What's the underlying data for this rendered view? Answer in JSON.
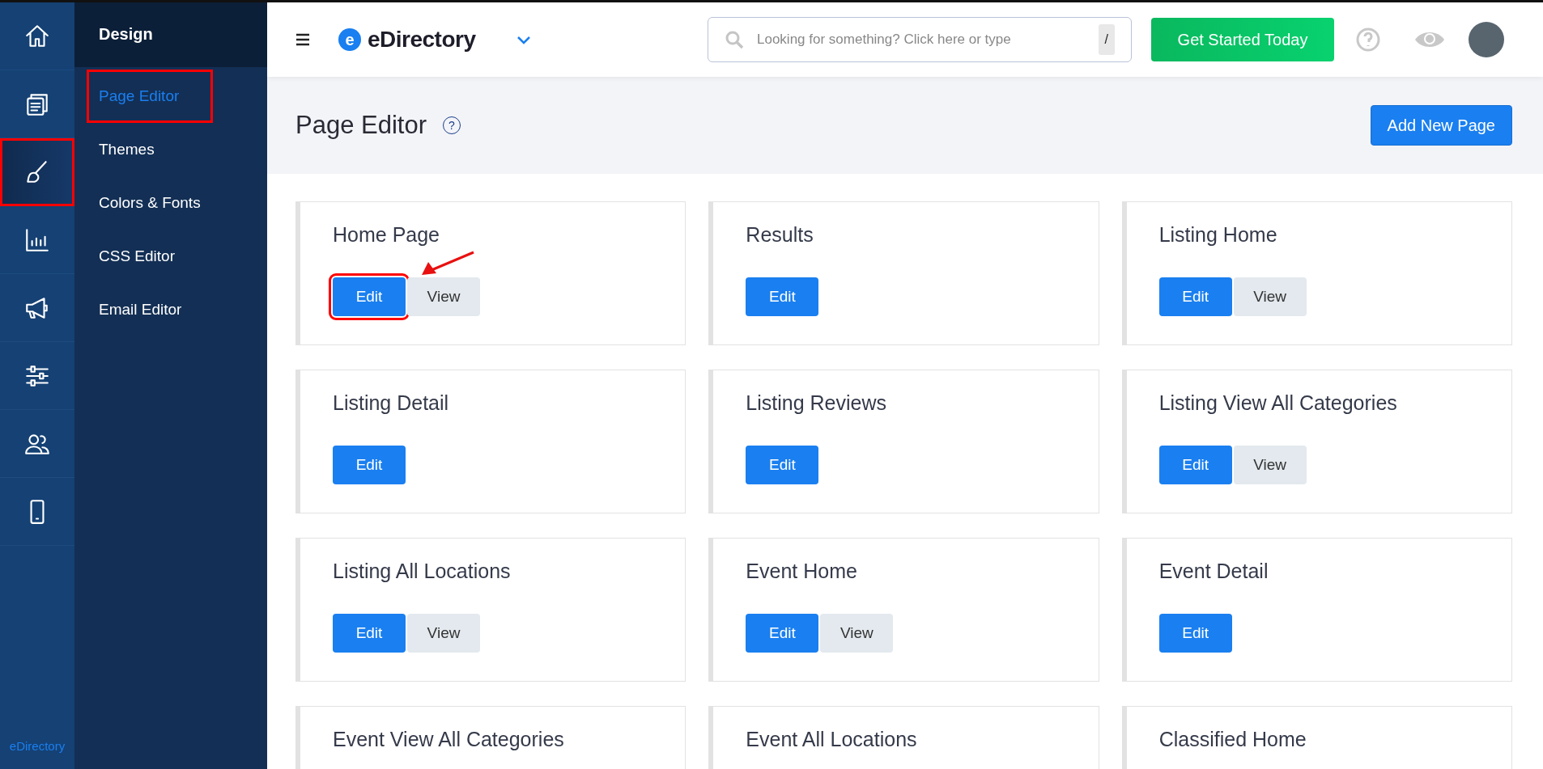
{
  "rail": [
    {
      "selected": false,
      "highlighted": false
    },
    {
      "selected": false,
      "highlighted": false
    },
    {
      "selected": true,
      "highlighted": true
    },
    {
      "selected": false,
      "highlighted": false
    },
    {
      "selected": false,
      "highlighted": false
    },
    {
      "selected": false,
      "highlighted": false
    },
    {
      "selected": false,
      "highlighted": false
    },
    {
      "selected": false,
      "highlighted": false
    }
  ],
  "rail_footer": "eDirectory",
  "submenu": {
    "title": "Design",
    "items": [
      {
        "label": "Page Editor",
        "selected": true,
        "highlighted": true
      },
      {
        "label": "Themes",
        "selected": false,
        "highlighted": false
      },
      {
        "label": "Colors & Fonts",
        "selected": false,
        "highlighted": false
      },
      {
        "label": "CSS Editor",
        "selected": false,
        "highlighted": false
      },
      {
        "label": "Email Editor",
        "selected": false,
        "highlighted": false
      }
    ]
  },
  "topbar": {
    "logo_letter": "e",
    "logo": "eDirectory",
    "search": {
      "placeholder": "Looking for something? Click here or type",
      "shortcut": "/"
    },
    "cta": "Get Started Today"
  },
  "header": {
    "title": "Page Editor",
    "help": "?",
    "add_button": "Add New Page"
  },
  "pages": [
    {
      "title": "Home Page",
      "buttons": [
        {
          "label": "Edit",
          "kind": "primary",
          "highlighted": true
        },
        {
          "label": "View",
          "kind": "secondary",
          "highlighted": false
        }
      ],
      "annotation_arrow": true
    },
    {
      "title": "Results",
      "buttons": [
        {
          "label": "Edit",
          "kind": "primary",
          "highlighted": false
        }
      ],
      "annotation_arrow": false
    },
    {
      "title": "Listing Home",
      "buttons": [
        {
          "label": "Edit",
          "kind": "primary",
          "highlighted": false
        },
        {
          "label": "View",
          "kind": "secondary",
          "highlighted": false
        }
      ],
      "annotation_arrow": false
    },
    {
      "title": "Listing Detail",
      "buttons": [
        {
          "label": "Edit",
          "kind": "primary",
          "highlighted": false
        }
      ],
      "annotation_arrow": false
    },
    {
      "title": "Listing Reviews",
      "buttons": [
        {
          "label": "Edit",
          "kind": "primary",
          "highlighted": false
        }
      ],
      "annotation_arrow": false
    },
    {
      "title": "Listing View All Categories",
      "buttons": [
        {
          "label": "Edit",
          "kind": "primary",
          "highlighted": false
        },
        {
          "label": "View",
          "kind": "secondary",
          "highlighted": false
        }
      ],
      "annotation_arrow": false
    },
    {
      "title": "Listing All Locations",
      "buttons": [
        {
          "label": "Edit",
          "kind": "primary",
          "highlighted": false
        },
        {
          "label": "View",
          "kind": "secondary",
          "highlighted": false
        }
      ],
      "annotation_arrow": false
    },
    {
      "title": "Event Home",
      "buttons": [
        {
          "label": "Edit",
          "kind": "primary",
          "highlighted": false
        },
        {
          "label": "View",
          "kind": "secondary",
          "highlighted": false
        }
      ],
      "annotation_arrow": false
    },
    {
      "title": "Event Detail",
      "buttons": [
        {
          "label": "Edit",
          "kind": "primary",
          "highlighted": false
        }
      ],
      "annotation_arrow": false
    },
    {
      "title": "Event View All Categories",
      "annotation_arrow": false
    },
    {
      "title": "Event All Locations",
      "annotation_arrow": false
    },
    {
      "title": "Classified Home",
      "annotation_arrow": false
    }
  ]
}
